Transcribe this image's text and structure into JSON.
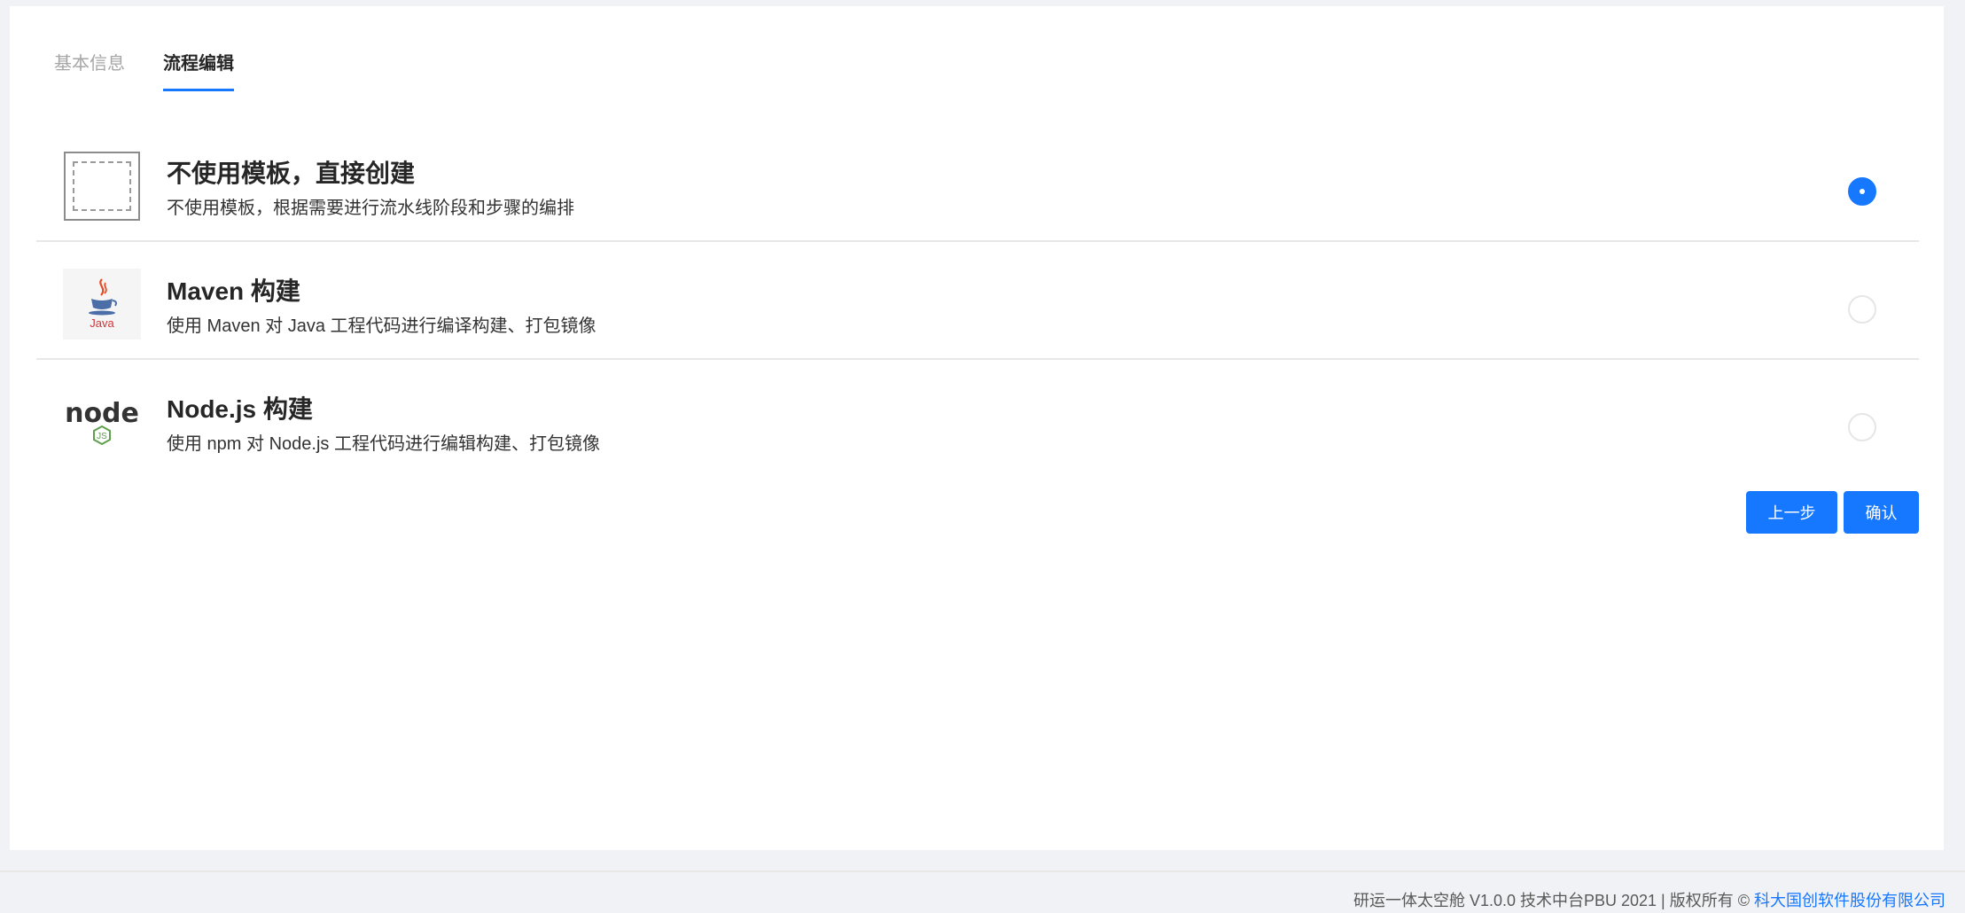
{
  "tabs": [
    {
      "label": "基本信息",
      "active": false
    },
    {
      "label": "流程编辑",
      "active": true
    }
  ],
  "templates": [
    {
      "title": "不使用模板，直接创建",
      "description": "不使用模板，根据需要进行流水线阶段和步骤的编排",
      "icon": "blank-template-icon",
      "selected": true
    },
    {
      "title": "Maven 构建",
      "description": "使用 Maven 对 Java 工程代码进行编译构建、打包镜像",
      "icon": "java-logo-icon",
      "icon_text": "Java",
      "selected": false
    },
    {
      "title": "Node.js 构建",
      "description": "使用 npm 对 Node.js 工程代码进行编辑构建、打包镜像",
      "icon": "nodejs-logo-icon",
      "icon_text": "node",
      "icon_badge": "JS",
      "selected": false
    }
  ],
  "actions": {
    "prev_label": "上一步",
    "confirm_label": "确认"
  },
  "footer": {
    "text": "研运一体太空舱 V1.0.0 技术中台PBU 2021 | 版权所有 © ",
    "company_link": "科大国创软件股份有限公司"
  },
  "colors": {
    "accent": "#1677ff",
    "background": "#f0f2f5",
    "panel": "#ffffff"
  }
}
